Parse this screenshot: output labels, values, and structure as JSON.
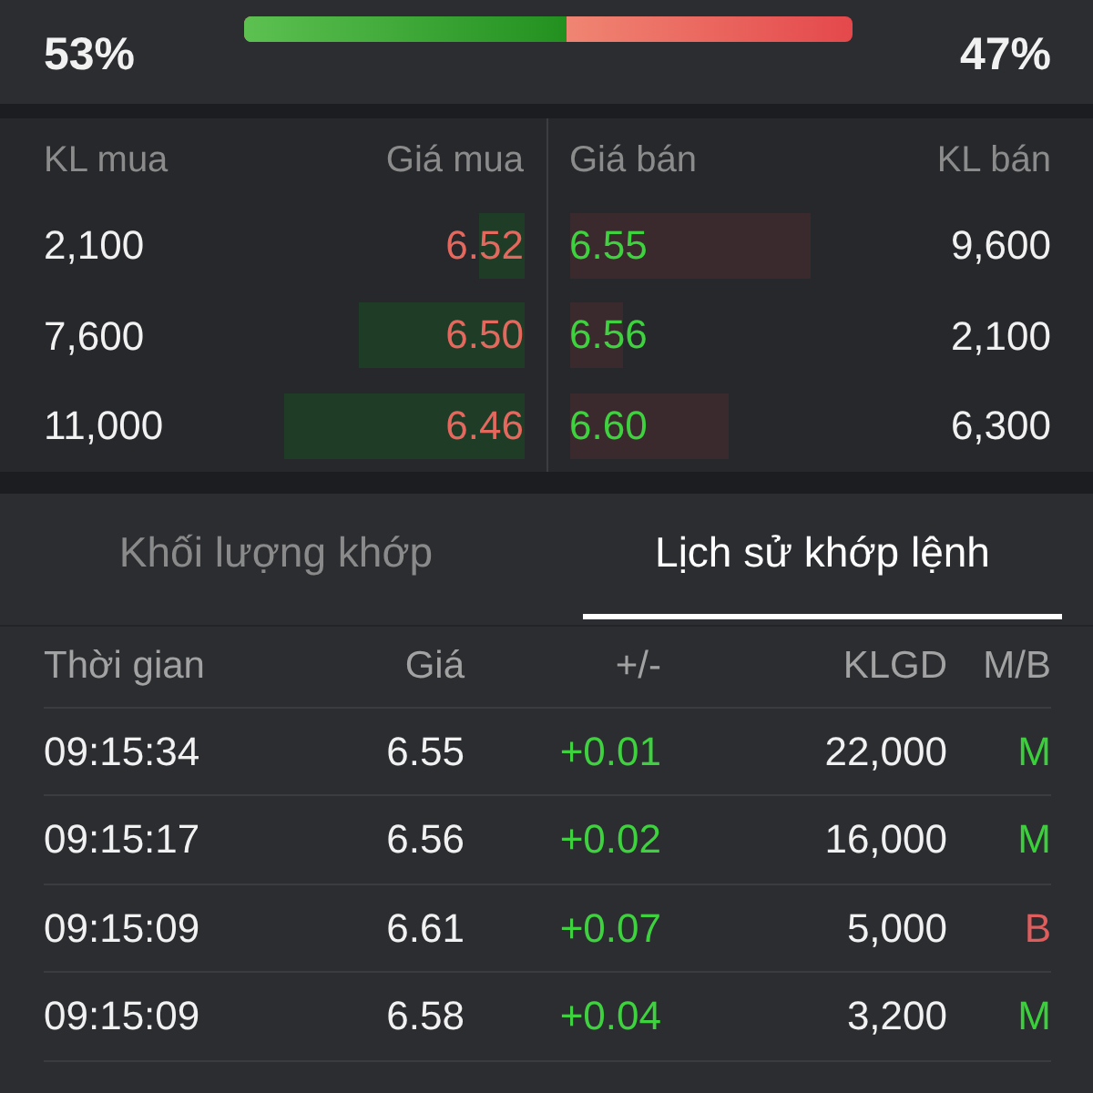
{
  "balance": {
    "buy_percent": "53%",
    "sell_percent": "47%",
    "level": 0.53
  },
  "order_book": {
    "columns": [
      "KL mua",
      "Giá mua",
      "Giá bán",
      "KL bán"
    ],
    "rows": [
      {
        "bid": {
          "volume": "2,100",
          "price": "6.52"
        },
        "ask": {
          "price": "6.55",
          "volume": "9,600"
        }
      },
      {
        "bid": {
          "volume": "7,600",
          "price": "6.50"
        },
        "ask": {
          "price": "6.56",
          "volume": "2,100"
        }
      },
      {
        "bid": {
          "volume": "11,000",
          "price": "6.46"
        },
        "ask": {
          "price": "6.60",
          "volume": "6,300"
        }
      }
    ]
  },
  "tabs": [
    {
      "label": "Khối lượng khớp",
      "selected": false
    },
    {
      "label": "Lịch sử khớp lệnh",
      "selected": true
    }
  ],
  "trades": {
    "columns": [
      "Thời gian",
      "Giá",
      "+/-",
      "KLGD",
      "M/B"
    ],
    "rows": [
      {
        "time": "09:15:34",
        "price": "6.55",
        "change": "+0.01",
        "volume": "22,000",
        "side": "M",
        "color": "#3ccf3c"
      },
      {
        "time": "09:15:17",
        "price": "6.56",
        "change": "+0.02",
        "volume": "16,000",
        "side": "M",
        "color": "#3ccf3c"
      },
      {
        "time": "09:15:09",
        "price": "6.61",
        "change": "+0.07",
        "volume": "5,000",
        "side": "B",
        "color": "#e05d5d"
      },
      {
        "time": "09:15:09",
        "price": "6.58",
        "change": "+0.04",
        "volume": "3,200",
        "side": "M",
        "color": "#3ccf3c"
      }
    ]
  }
}
